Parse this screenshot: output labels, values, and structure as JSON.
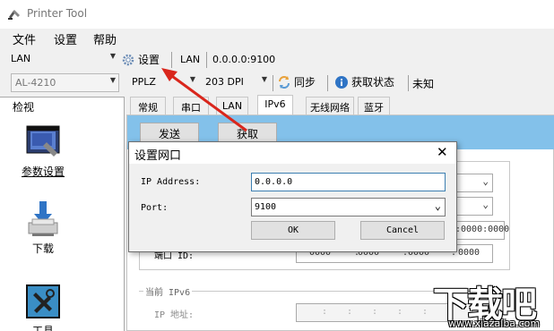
{
  "window": {
    "title": "Printer Tool"
  },
  "menu": {
    "items": [
      "文件",
      "设置",
      "帮助"
    ]
  },
  "toolbar1": {
    "connection": "LAN",
    "settings_label": "设置",
    "conn_type": "LAN",
    "address": "0.0.0.0:9100"
  },
  "toolbar2": {
    "model": "AL-4210",
    "language": "PPLZ",
    "dpi": "203 DPI",
    "sync_label": "同步",
    "status_label": "获取状态",
    "status_value": "未知"
  },
  "sidebar": {
    "header": "检视",
    "items": [
      "参数设置",
      "下载",
      "工具"
    ]
  },
  "tabs": [
    "常规",
    "串口",
    "LAN",
    "IPv6",
    "无线网络",
    "蓝牙"
  ],
  "actions": {
    "send": "发送",
    "get": "获取"
  },
  "ipv6": {
    "port_id_label": "端口 ID:",
    "port_id_values": [
      "0000",
      "0000",
      "0000",
      "0000"
    ],
    "partial_value": ":0000:0000",
    "current_label": "当前 IPv6",
    "ip_label": "IP 地址:"
  },
  "dialog": {
    "title": "设置网口",
    "ip_label": "IP Address:",
    "ip_value": "0.0.0.0",
    "port_label": "Port:",
    "port_value": "9100",
    "ok": "OK",
    "cancel": "Cancel",
    "close_icon": "close-icon"
  },
  "watermark": {
    "main": "下载吧",
    "url": "www.xiazaiba.com"
  },
  "colors": {
    "accent_blue": "#83c1ea",
    "arrow_red": "#d9261c"
  }
}
